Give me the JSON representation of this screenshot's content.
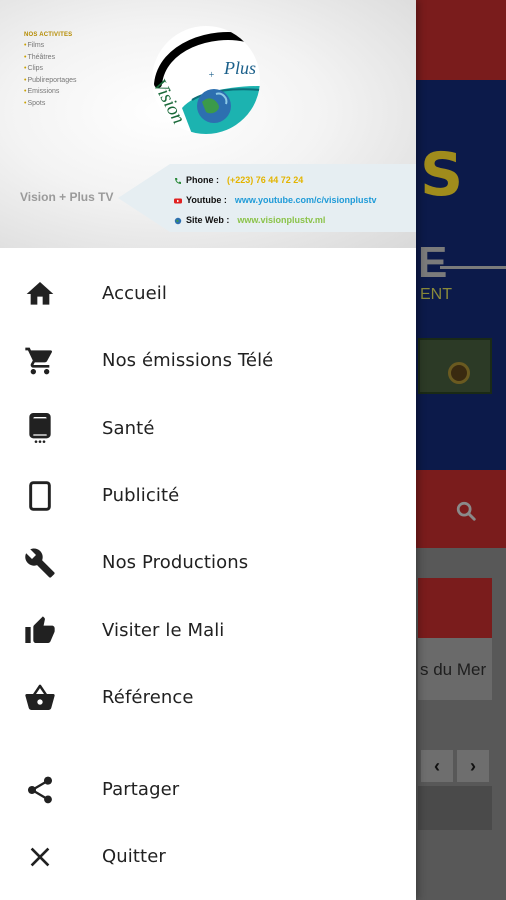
{
  "background": {
    "banner_letter_s": "S",
    "banner_letter_e": "E",
    "banner_subtext": "ENT",
    "card_text": "s du Mer",
    "nav_prev": "‹",
    "nav_next": "›"
  },
  "header": {
    "activities_title": "NOS ACTIVITES",
    "activities": [
      "Films",
      "Théâtres",
      "Clips",
      "Publireportages",
      "Emissions",
      "Spots"
    ],
    "logo_word1": "Vision",
    "logo_word2": "Plus",
    "logo_plus": "+",
    "brand": "Vision + Plus TV",
    "contacts": [
      {
        "label": "Phone :",
        "value": "(+223) 76 44 72 24",
        "color": "#e3b400"
      },
      {
        "label": "Youtube :",
        "value": "www.youtube.com/c/visionplustv",
        "color": "#1f9bd8"
      },
      {
        "label": "Site Web :",
        "value": "www.visionplustv.ml",
        "color": "#8bc34a"
      }
    ]
  },
  "menu": {
    "items": [
      {
        "label": "Accueil",
        "icon": "home-icon"
      },
      {
        "label": "Nos émissions Télé",
        "icon": "cart-icon"
      },
      {
        "label": "Santé",
        "icon": "mobile-phone-icon"
      },
      {
        "label": "Publicité",
        "icon": "tablet-icon"
      },
      {
        "label": "Nos Productions",
        "icon": "wrench-icon"
      },
      {
        "label": "Visiter le Mali",
        "icon": "thumb-up-icon"
      },
      {
        "label": "Référence",
        "icon": "basket-icon"
      },
      {
        "label": "Partager",
        "icon": "share-icon"
      },
      {
        "label": "Quitter",
        "icon": "close-icon"
      }
    ]
  }
}
